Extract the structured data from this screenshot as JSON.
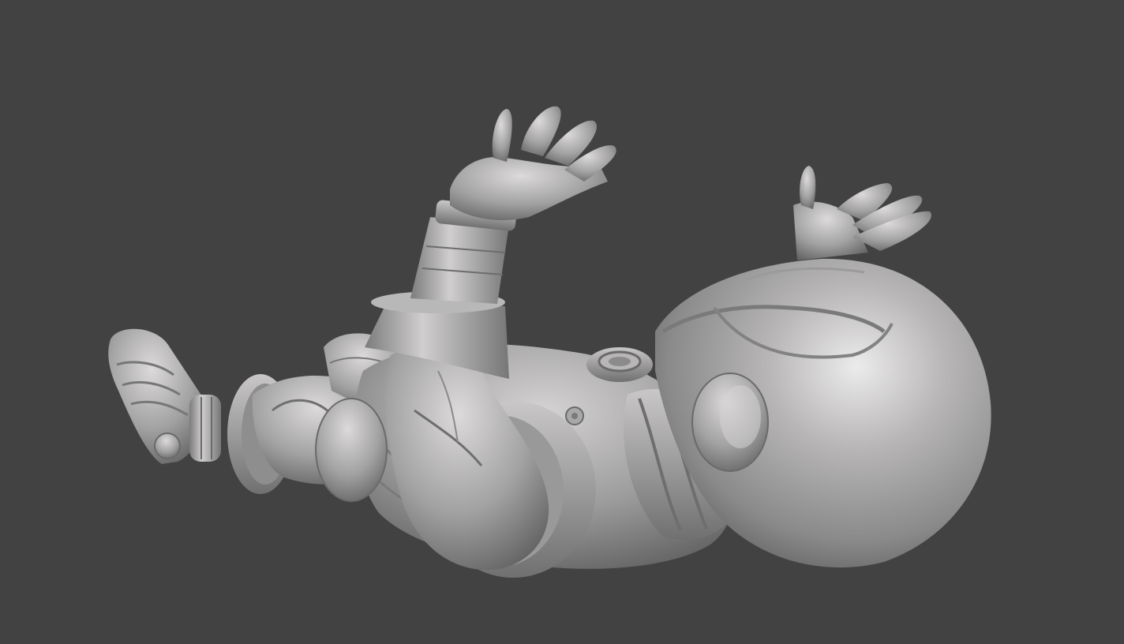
{
  "viewport": {
    "background": "#424242"
  },
  "model": {
    "material_color": "#9a9a9a",
    "highlight_color": "#e6e4e4",
    "shadow_color": "#4e4e4e"
  }
}
